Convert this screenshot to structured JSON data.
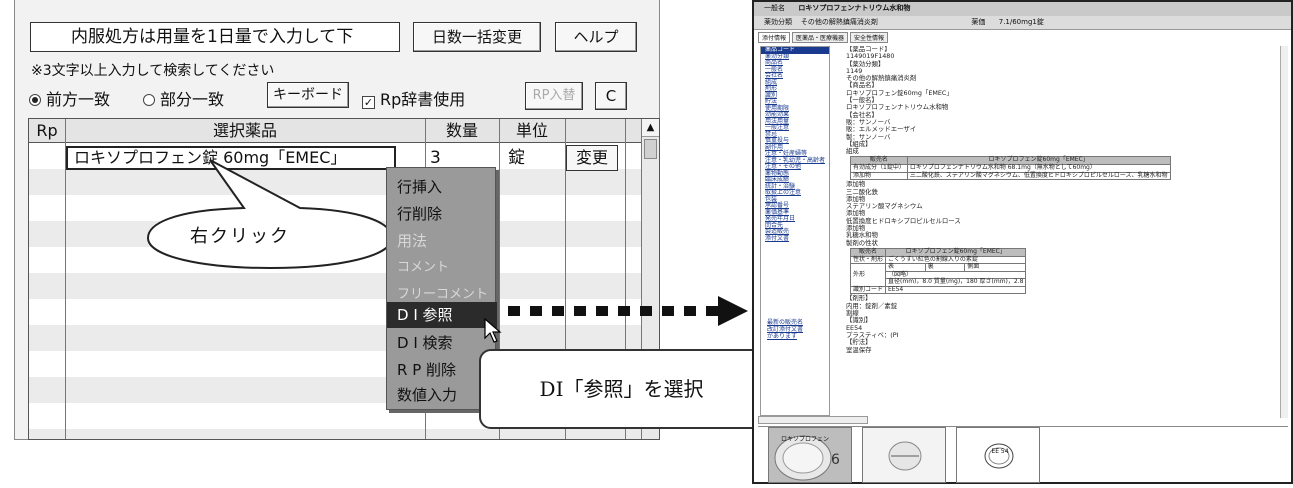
{
  "left_panel": {
    "instruction_field_value": "内服処方は用量を1日量で入力して下",
    "days_bulk_change_label": "日数一括変更",
    "help_label": "ヘルプ",
    "search_note": "※3文字以上入力して検索してください",
    "radio_prefix_label": "前方一致",
    "radio_partial_label": "部分一致",
    "keyboard_label": "キーボード",
    "rp_dictionary_label": "Rp辞書使用",
    "rp_swap_label": "RP入替",
    "c_label": "C",
    "grid_headers": {
      "rp": "Rp",
      "drug": "選択薬品",
      "quantity": "数量",
      "unit": "単位"
    },
    "row1": {
      "drug": "ロキソプロフェン錠 60mg「EMEC」",
      "quantity": "3",
      "unit": "錠",
      "change_label": "変更"
    }
  },
  "context_menu": {
    "items": [
      {
        "label": "行挿入",
        "state": "enabled"
      },
      {
        "label": "行削除",
        "state": "enabled"
      },
      {
        "label": "用法",
        "state": "disabled"
      },
      {
        "label": "コメント",
        "state": "disabled"
      },
      {
        "label": "フリーコメント",
        "state": "disabled"
      },
      {
        "label": "D I 参照",
        "state": "selected"
      },
      {
        "label": "D I 検索",
        "state": "enabled"
      },
      {
        "label": "R P 削除",
        "state": "enabled"
      },
      {
        "label": "数値入力",
        "state": "enabled"
      }
    ]
  },
  "callouts": {
    "right_click": "右クリック",
    "select_di": "DI「参照」を選択"
  },
  "di_window": {
    "generic_label": "一般名",
    "generic_value": "ロキソプロフェンナトリウム水和物",
    "category_label": "薬効分類",
    "category_value": "その他の解熱鎮痛消炎剤",
    "price_label": "薬価",
    "price_value": "7.1/60mg1錠",
    "tabs": [
      "添付情報",
      "医薬品・医療機器",
      "安全性情報"
    ],
    "nav_items": [
      "薬品コード",
      "薬効分類",
      "商品名",
      "一般名",
      "会社名",
      "組成",
      "剤形",
      "識別",
      "貯法",
      "使用期限",
      "効能効果",
      "用法用量",
      "一般注意",
      "禁忌",
      "慎重投与",
      "副作用",
      "注意・妊産婦等",
      "注意・乳幼児・高齢者",
      "注意・その他",
      "薬物動態",
      "臨床成績",
      "統計・治験",
      "取扱上の注意",
      "包装",
      "承認番号",
      "薬価基準",
      "発売年月日",
      "問合先",
      "製造販売",
      "添付文書"
    ],
    "nav_extra": [
      "最新の販売名",
      "改訂添付文書",
      "があります"
    ],
    "content": {
      "code_head": "【薬品コード】",
      "code_value": "1149019F1480",
      "class_head": "【薬効分類】",
      "class_code": "1149",
      "class_value": "その他の解熱鎮痛消炎剤",
      "brand_head": "【商品名】",
      "brand_value": "ロキソプロフェン錠60mg「EMEC」",
      "generic_head": "【一般名】",
      "generic_value": "ロキソプロフェンナトリウム水和物",
      "company_head": "【会社名】",
      "company_1": "販：サンノーバ",
      "company_2": "販：エルメッドエーザイ",
      "company_3": "製：サンノーバ",
      "composition_head": "【組成】",
      "composition_sub": "組成",
      "comp_table": {
        "h1": "販売名",
        "h2": "ロキソプロフェン錠60mg「EMEC」",
        "r1a": "有効成分（1錠中）",
        "r1b": "ロキソプロフェンナトリウム水和物 68.1mg（無水物として60mg）",
        "r2a": "添加物",
        "r2b": "三二酸化鉄、ステアリン酸マグネシウム、低置換度ヒドロキシプロピルセルロース、乳糖水和物"
      },
      "additives": [
        "添加物",
        "三二酸化鉄",
        "添加物",
        "ステアリン酸マグネシウム",
        "添加物",
        "低置換度ヒドロキシプロピルセルロース",
        "添加物",
        "乳糖水和物"
      ],
      "form_sub": "製剤の性状",
      "form_table": {
        "h1": "販売名",
        "h2": "ロキソプロフェン錠60mg「EMEC」",
        "r1a": "性状・剤形",
        "r1b": "ごくうすい紅色の割線入りの素錠",
        "front": "表",
        "back": "裏",
        "side": "側面",
        "shape": "外形",
        "shape_val": "（図略）",
        "dims": "直径(mm)，8.0 質量(mg)，180 厚さ(mm)，2.8",
        "code_a": "識別コード",
        "code_b": "EE54"
      },
      "dosage_head": "【剤形】",
      "dosage_value": "内用：錠剤／素錠",
      "dosage_sub": "割線",
      "id_head": "【識別】",
      "id_value": "EE54",
      "id_sub": "プラスティベ：(PI",
      "storage_head": "【貯法】",
      "storage_value": "室温保存"
    },
    "image_caption": "ロキソプロフェン",
    "image_mark": "EE 54"
  },
  "colors": {
    "menu_bg": "#9a9a9a",
    "menu_selected": "#2b2b2b",
    "link_blue": "#1a3a8f"
  }
}
